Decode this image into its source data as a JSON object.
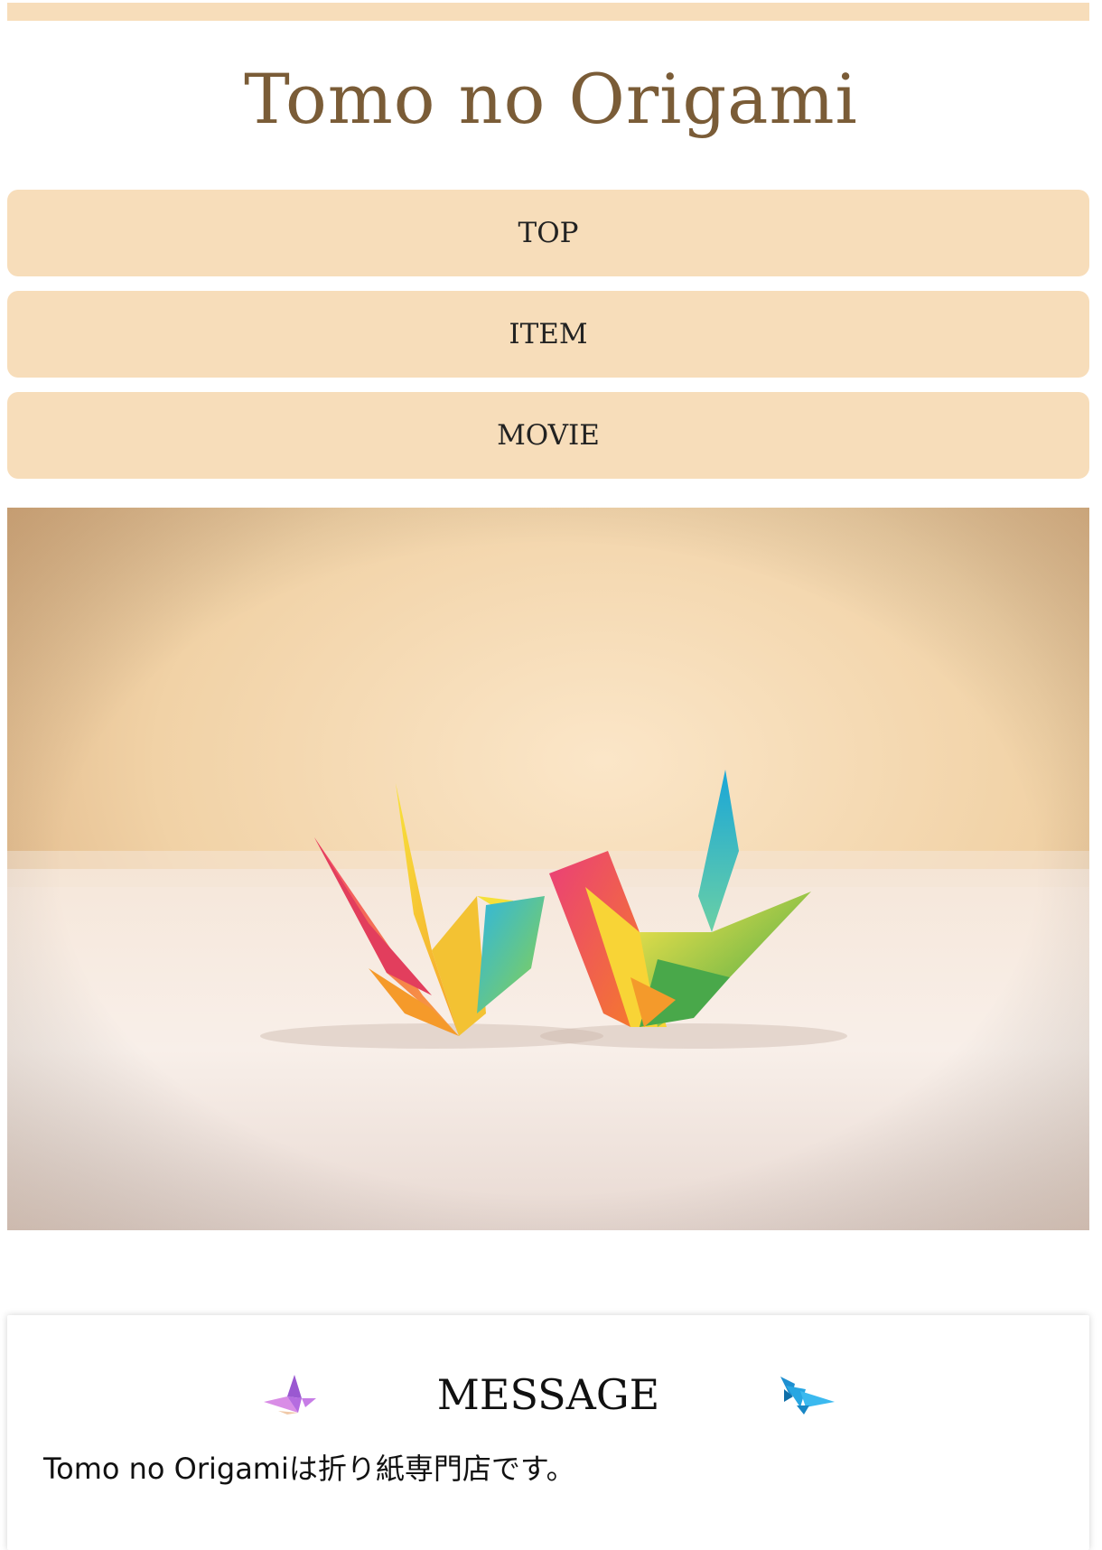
{
  "header": {
    "site_title": "Tomo no Origami"
  },
  "nav": {
    "items": [
      {
        "label": "TOP"
      },
      {
        "label": "ITEM"
      },
      {
        "label": "MOVIE"
      }
    ]
  },
  "hero": {
    "image": "origami-cranes-photo"
  },
  "message": {
    "title": "MESSAGE",
    "body": "Tomo no Origamiは折り紙専門店です。",
    "left_icon": "origami-bird-purple-icon",
    "right_icon": "origami-bird-blue-icon"
  },
  "colors": {
    "accent": "#f7ddba",
    "title": "#7a5c37",
    "text": "#222222"
  }
}
